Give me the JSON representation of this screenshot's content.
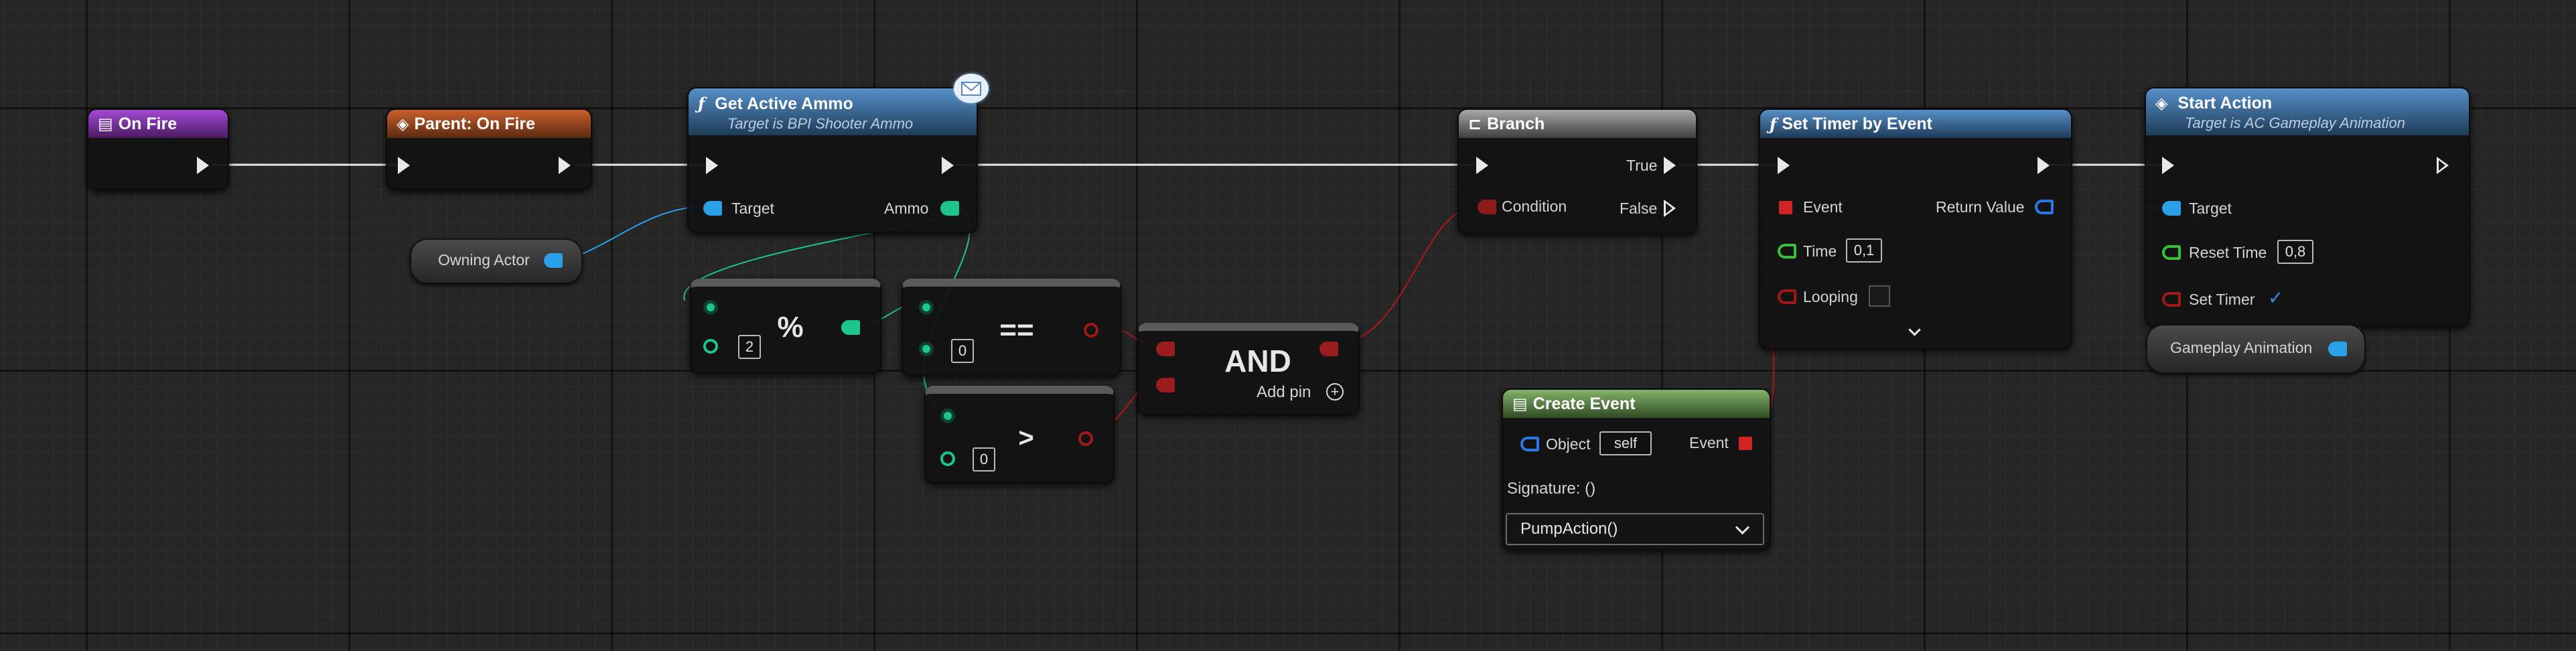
{
  "nodes": {
    "on_fire": {
      "title": "On Fire"
    },
    "parent_on_fire": {
      "title": "Parent: On Fire"
    },
    "get_active_ammo": {
      "title": "Get Active Ammo",
      "subtitle": "Target is BPI Shooter Ammo",
      "target_label": "Target",
      "ammo_label": "Ammo"
    },
    "owning_actor": {
      "label": "Owning Actor"
    },
    "modulo": {
      "symbol": "%",
      "value": "2"
    },
    "equals": {
      "symbol": "==",
      "value": "0"
    },
    "greater": {
      "symbol": ">",
      "value": "0"
    },
    "and": {
      "symbol": "AND",
      "add_pin": "Add pin"
    },
    "branch": {
      "title": "Branch",
      "condition": "Condition",
      "true_label": "True",
      "false_label": "False"
    },
    "create_event": {
      "title": "Create Event",
      "object_label": "Object",
      "object_value": "self",
      "event_label": "Event",
      "signature": "Signature: ()",
      "function": "PumpAction()"
    },
    "set_timer": {
      "title": "Set Timer by Event",
      "event_label": "Event",
      "return_label": "Return Value",
      "time_label": "Time",
      "time_value": "0,1",
      "looping_label": "Looping"
    },
    "start_action": {
      "title": "Start Action",
      "subtitle": "Target is AC Gameplay Animation",
      "target_label": "Target",
      "reset_label": "Reset Time",
      "reset_value": "0,8",
      "set_timer_label": "Set Timer"
    },
    "gameplay_animation": {
      "label": "Gameplay Animation"
    }
  },
  "colors": {
    "exec_wire": "#e8e8e8",
    "object_wire": "#2aa0e8",
    "int_wire": "#1cc68a",
    "bool_wire": "#b01818"
  },
  "icons": {
    "event": "event-icon",
    "function": "function-icon",
    "branch": "branch-icon",
    "message": "message-envelope-icon"
  }
}
